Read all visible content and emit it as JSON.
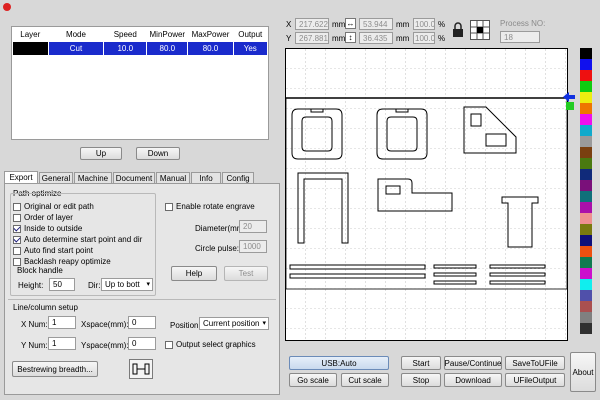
{
  "layers": {
    "columns": [
      "Layer",
      "Mode",
      "Speed",
      "MinPower",
      "MaxPower",
      "Output"
    ],
    "rows": [
      {
        "color": "#000000",
        "mode": "Cut",
        "speed": "10.0",
        "min_power": "80.0",
        "max_power": "80.0",
        "output": "Yes"
      }
    ],
    "up_label": "Up",
    "down_label": "Down"
  },
  "tabs": [
    "Export",
    "General",
    "Machine",
    "Document",
    "Manual",
    "Info",
    "Config"
  ],
  "active_tab": "Export",
  "path_optimize": {
    "title": "Path optimize",
    "options": [
      {
        "label": "Original or edit path",
        "checked": false
      },
      {
        "label": "Order of layer",
        "checked": false
      },
      {
        "label": "Inside to outside",
        "checked": true
      },
      {
        "label": "Auto determine start point and dir",
        "checked": true
      },
      {
        "label": "Auto find start point",
        "checked": false
      },
      {
        "label": "Backlash reapy optimize",
        "checked": false
      }
    ],
    "block_handle_label": "Block handle",
    "height_label": "Height:",
    "height_value": "50",
    "dir_label": "Dir:",
    "dir_value": "Up to bott"
  },
  "rotate": {
    "enable_label": "Enable rotate engrave",
    "enable_checked": false,
    "diameter_label": "Diameter(mm):",
    "diameter_value": "20",
    "circle_pulse_label": "Circle pulse:",
    "circle_pulse_value": "1000",
    "help_label": "Help",
    "test_label": "Test"
  },
  "line_column": {
    "title": "Line/column setup",
    "xnum_label": "X Num:",
    "xnum_value": "1",
    "xspace_label": "Xspace(mm):",
    "xspace_value": "0",
    "ynum_label": "Y Num:",
    "ynum_value": "1",
    "yspace_label": "Yspace(mm):",
    "yspace_value": "0",
    "position_label": "Position:",
    "position_value": "Current position",
    "output_select_label": "Output select graphics",
    "output_select_checked": false,
    "bestrewing_label": "Bestrewing breadth..."
  },
  "coords": {
    "x_label": "X",
    "x_value": "217.622",
    "y_label": "Y",
    "y_value": "267.881",
    "unit": "mm",
    "width_value": "53.944",
    "height_value": "36.435",
    "scale_x": "100.0",
    "scale_y": "100.0",
    "percent": "%",
    "process_no_label": "Process NO:",
    "process_no_value": "18"
  },
  "palette": [
    "#000000",
    "#1010ee",
    "#ee1010",
    "#10cc10",
    "#eeee10",
    "#ee7700",
    "#ee10ee",
    "#10aacc",
    "#9a9a9a",
    "#7a4010",
    "#4a7a10",
    "#102a7a",
    "#7a107a",
    "#10707a",
    "#aa10aa",
    "#ee9090",
    "#7a7a10",
    "#10107a",
    "#ee5010",
    "#107a50",
    "#cc10cc",
    "#10eeee",
    "#5050aa",
    "#aa5050",
    "#808080",
    "#303030"
  ],
  "bottom": {
    "usb_label": "USB:Auto",
    "go_scale_label": "Go scale",
    "cut_scale_label": "Cut scale",
    "start_label": "Start",
    "stop_label": "Stop",
    "pause_label": "Pause/Continue",
    "download_label": "Download",
    "save_label": "SaveToUFile",
    "ufile_label": "UFileOutput",
    "about_label": "About"
  }
}
